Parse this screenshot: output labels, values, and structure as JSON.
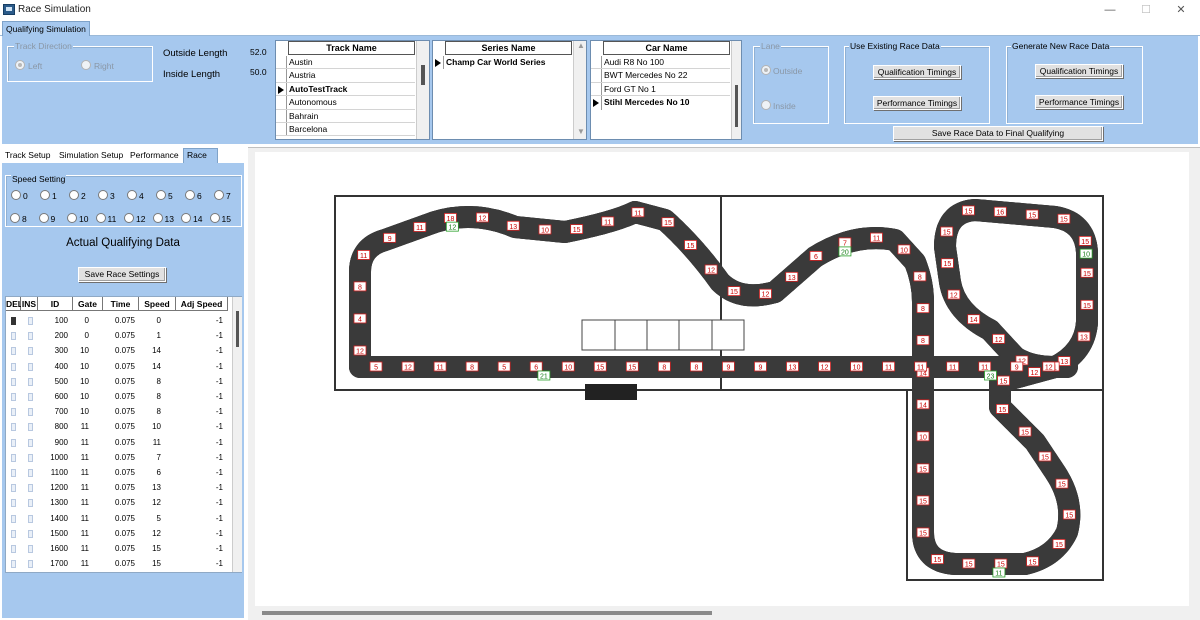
{
  "window": {
    "title": "Race Simulation",
    "controls": {
      "minimize": "—",
      "maximize": "☐",
      "close": "✕"
    }
  },
  "main_tab": "Qualifying Simulation",
  "track_direction": {
    "title": "Track Direction",
    "left": "Left",
    "right": "Right",
    "selected": "Left"
  },
  "lengths": {
    "outside_label": "Outside Length",
    "outside_value": "52.0",
    "inside_label": "Inside Length",
    "inside_value": "50.0"
  },
  "track_list": {
    "header": "Track Name",
    "items": [
      "Austin",
      "Austria",
      "AutoTestTrack",
      "Autonomous",
      "Bahrain",
      "Barcelona"
    ],
    "selected": "AutoTestTrack"
  },
  "series_list": {
    "header": "Series Name",
    "items": [
      "Champ Car World Series"
    ],
    "selected": "Champ Car World Series"
  },
  "car_list": {
    "header": "Car Name",
    "items": [
      "Audi R8 No 100",
      "BWT Mercedes No 22",
      "Ford GT No 1",
      "Stihl Mercedes No 10"
    ],
    "selected": "Stihl Mercedes No 10"
  },
  "lane": {
    "title": "Lane",
    "outside": "Outside",
    "inside": "Inside",
    "selected": "Outside"
  },
  "existing_data": {
    "title": "Use Existing Race Data",
    "qualification": "Qualification Timings",
    "performance": "Performance Timings"
  },
  "generate_data": {
    "title": "Generate New Race Data",
    "qualification": "Qualification Timings",
    "performance": "Performance Timings"
  },
  "save_final": "Save Race Data to Final Qualifying",
  "left_tabs": [
    "Track Setup",
    "Simulation Setup",
    "Performance",
    "Race"
  ],
  "active_left_tab": "Race",
  "speed_setting": {
    "title": "Speed Setting",
    "options": [
      "0",
      "1",
      "2",
      "3",
      "4",
      "5",
      "6",
      "7",
      "8",
      "9",
      "10",
      "11",
      "12",
      "13",
      "14",
      "15"
    ]
  },
  "qualifying_heading": "Actual Qualifying Data",
  "save_race_settings": "Save Race Settings",
  "table": {
    "columns": [
      "DEL",
      "INS",
      "ID",
      "Gate",
      "Time",
      "Speed",
      "Adj Speed"
    ],
    "rows": [
      [
        "100",
        "0",
        "0.075",
        "0",
        "-1"
      ],
      [
        "200",
        "0",
        "0.075",
        "1",
        "-1"
      ],
      [
        "300",
        "10",
        "0.075",
        "14",
        "-1"
      ],
      [
        "400",
        "10",
        "0.075",
        "14",
        "-1"
      ],
      [
        "500",
        "10",
        "0.075",
        "8",
        "-1"
      ],
      [
        "600",
        "10",
        "0.075",
        "8",
        "-1"
      ],
      [
        "700",
        "10",
        "0.075",
        "8",
        "-1"
      ],
      [
        "800",
        "11",
        "0.075",
        "10",
        "-1"
      ],
      [
        "900",
        "11",
        "0.075",
        "11",
        "-1"
      ],
      [
        "1000",
        "11",
        "0.075",
        "7",
        "-1"
      ],
      [
        "1100",
        "11",
        "0.075",
        "6",
        "-1"
      ],
      [
        "1200",
        "11",
        "0.075",
        "13",
        "-1"
      ],
      [
        "1300",
        "11",
        "0.075",
        "12",
        "-1"
      ],
      [
        "1400",
        "11",
        "0.075",
        "5",
        "-1"
      ],
      [
        "1500",
        "11",
        "0.075",
        "12",
        "-1"
      ],
      [
        "1600",
        "11",
        "0.075",
        "15",
        "-1"
      ],
      [
        "1700",
        "11",
        "0.075",
        "15",
        "-1"
      ]
    ]
  },
  "track_labels_red": [
    "12",
    "4",
    "8",
    "11",
    "9",
    "11",
    "18",
    "12",
    "13",
    "10",
    "15",
    "11",
    "11",
    "15",
    "15",
    "12",
    "15",
    "12",
    "13",
    "6",
    "7",
    "11",
    "10",
    "8",
    "8",
    "8",
    "14",
    "14",
    "10",
    "15",
    "15",
    "15",
    "15",
    "15",
    "15",
    "15",
    "15",
    "15",
    "15",
    "15",
    "15",
    "15",
    "15",
    "12",
    "13",
    "13",
    "15",
    "15",
    "15",
    "15",
    "15",
    "16",
    "15",
    "15",
    "15",
    "12",
    "14",
    "12",
    "12",
    "11",
    "12",
    "9",
    "11",
    "11",
    "11",
    "11",
    "10",
    "12",
    "13",
    "9",
    "9",
    "8",
    "8",
    "15",
    "15",
    "10",
    "6",
    "5",
    "8",
    "11",
    "12",
    "5"
  ],
  "track_labels_green": [
    "12",
    "20",
    "11",
    "10",
    "23",
    "21"
  ],
  "colors": {
    "panel": "#a6c8ee",
    "track": "#3a3a3a",
    "lane_outer": "#d02020",
    "lane_inner": "#2040c0",
    "accent": "#2aa02a"
  }
}
